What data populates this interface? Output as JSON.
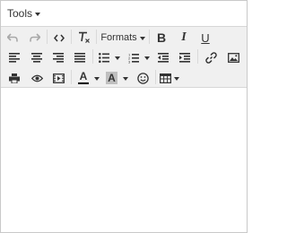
{
  "menubar": {
    "tools_label": "Tools"
  },
  "toolbar": {
    "formats_label": "Formats",
    "bold_label": "B",
    "italic_label": "I",
    "underline_label": "U",
    "icons": {
      "undo": "undo-icon",
      "redo": "redo-icon",
      "code": "code-icon",
      "clear_format": "clear-formatting-icon",
      "align_left": "align-left-icon",
      "align_center": "align-center-icon",
      "align_right": "align-right-icon",
      "justify": "justify-icon",
      "bullet_list": "bullet-list-icon",
      "numbered_list": "numbered-list-icon",
      "outdent": "outdent-icon",
      "indent": "indent-icon",
      "link": "link-icon",
      "image": "image-icon",
      "print": "print-icon",
      "preview": "preview-icon",
      "media": "media-icon",
      "text_color": "text-color-icon",
      "background_color": "background-color-icon",
      "emoticons": "emoticons-icon",
      "table": "table-icon"
    },
    "text_color_glyph": "A",
    "background_color_glyph": "A"
  },
  "colors": {
    "toolbar_bg": "#f0f0f0",
    "disabled": "#a8a8a8",
    "icon": "#333333",
    "text_color_swatch": "#000000",
    "background_color_swatch": "#bfbfbf"
  },
  "editor": {
    "content": ""
  }
}
